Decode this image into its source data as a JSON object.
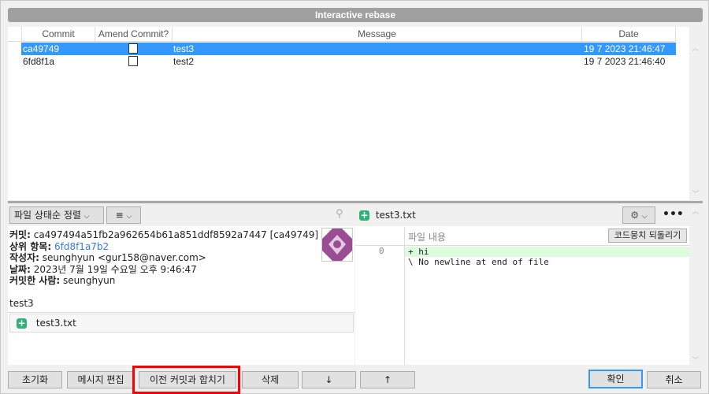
{
  "window": {
    "title": "Interactive rebase"
  },
  "table": {
    "headers": [
      "Commit",
      "Amend Commit?",
      "Message",
      "Date"
    ],
    "rows": [
      {
        "commit": "ca49749",
        "message": "test3",
        "date": "19 7 2023 21:46:47",
        "selected": true
      },
      {
        "commit": "6fd8f1a",
        "message": "test2",
        "date": "19 7 2023 21:46:40",
        "selected": false
      }
    ]
  },
  "left": {
    "sort_label": "파일 상태순 정렬",
    "commit_label": "커밋:",
    "commit_value": "ca497494a51fb2a962654b61a851ddf8592a7447 [ca49749]",
    "parent_label": "상위 항목:",
    "parent_value": "6fd8f1a7b2",
    "author_label": "작성자:",
    "author_value": "seunghyun <gur158@naver.com>",
    "date_label": "날짜:",
    "date_value": "2023년 7월 19일 수요일 오후 9:46:47",
    "committer_label": "커밋한 사람:",
    "committer_value": "seunghyun",
    "message": "test3",
    "file": "test3.txt"
  },
  "right": {
    "file": "test3.txt",
    "content_header": "파일 내용",
    "revert_hunk": "코드뭉치 되돌리기",
    "line_no": "0",
    "lines": [
      "+ hi",
      "\\  No newline at end of file"
    ]
  },
  "buttons": {
    "reset": "초기화",
    "edit_message": "메시지 편집",
    "squash": "이전 커밋과 합치기",
    "delete": "삭제",
    "down": "↓",
    "up": "↑",
    "ok": "확인",
    "cancel": "취소"
  },
  "colors": {
    "selection": "#3399ff",
    "added": "#2fb274",
    "highlight": "#ff0000",
    "link": "#3a7bd5"
  }
}
